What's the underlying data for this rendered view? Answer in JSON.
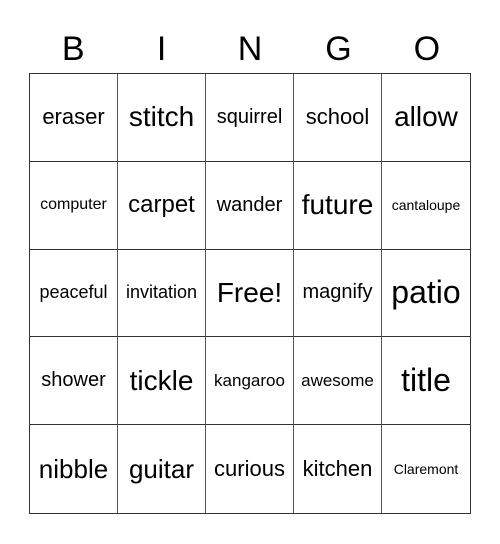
{
  "header": {
    "letters": [
      "B",
      "I",
      "N",
      "G",
      "O"
    ]
  },
  "grid": {
    "rows": [
      [
        "eraser",
        "stitch",
        "squirrel",
        "school",
        "allow"
      ],
      [
        "computer",
        "carpet",
        "wander",
        "future",
        "cantaloupe"
      ],
      [
        "peaceful",
        "invitation",
        "Free!",
        "magnify",
        "patio"
      ],
      [
        "shower",
        "tickle",
        "kangaroo",
        "awesome",
        "title"
      ],
      [
        "nibble",
        "guitar",
        "curious",
        "kitchen",
        "Claremont"
      ]
    ]
  }
}
